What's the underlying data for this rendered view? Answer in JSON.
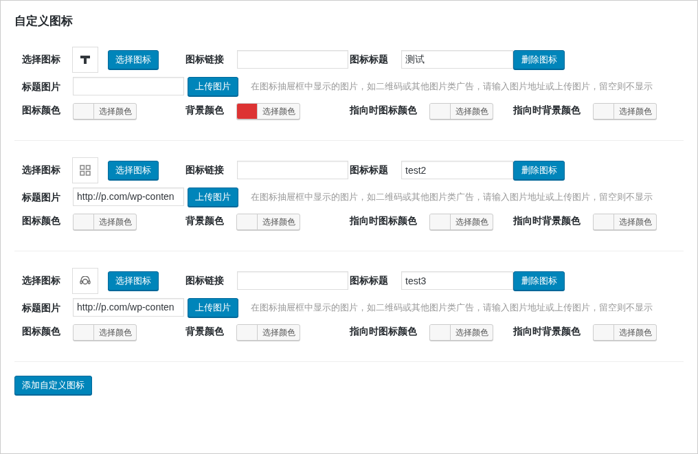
{
  "title": "自定义图标",
  "groups": [
    {
      "icon_label": "选择图标",
      "icon_preview": {
        "kind": "tee"
      },
      "choose_button": "选择图标",
      "link_label": "图标链接",
      "title_label": "图标标题",
      "title_value": "测试",
      "delete_button": "删除图标",
      "image_label": "标题图片",
      "upload_button": "上传图片",
      "hint": "在图标抽屉框中显示的图片，如二维码或其他图片类广告，请输入图片地址或上传图片，留空则不显示",
      "colors": [
        {
          "label": "图标颜色",
          "button": "选择颜色"
        },
        {
          "label": "背景颜色",
          "button": "选择颜色",
          "color": "#dd3333"
        },
        {
          "label": "指向时图标颜色",
          "button": "选择颜色"
        },
        {
          "label": "指向时背景颜色",
          "button": "选择颜色"
        }
      ]
    },
    {
      "icon_label": "选择图标",
      "icon_preview": {
        "kind": "grid"
      },
      "choose_button": "选择图标",
      "link_label": "图标链接",
      "title_label": "图标标题",
      "title_value": "test2",
      "delete_button": "删除图标",
      "image_label": "标题图片",
      "image_value": "http://p.com/wp-conten",
      "upload_button": "上传图片",
      "hint": "在图标抽屉框中显示的图片，如二维码或其他图片类广告，请输入图片地址或上传图片，留空则不显示",
      "colors": [
        {
          "label": "图标颜色",
          "button": "选择颜色"
        },
        {
          "label": "背景颜色",
          "button": "选择颜色"
        },
        {
          "label": "指向时图标颜色",
          "button": "选择颜色"
        },
        {
          "label": "指向时背景颜色",
          "button": "选择颜色"
        }
      ]
    },
    {
      "icon_label": "选择图标",
      "icon_preview": {
        "kind": "headset"
      },
      "choose_button": "选择图标",
      "link_label": "图标链接",
      "title_label": "图标标题",
      "title_value": "test3",
      "delete_button": "删除图标",
      "image_label": "标题图片",
      "image_value": "http://p.com/wp-conten",
      "upload_button": "上传图片",
      "hint": "在图标抽屉框中显示的图片，如二维码或其他图片类广告，请输入图片地址或上传图片，留空则不显示",
      "colors": [
        {
          "label": "图标颜色",
          "button": "选择颜色"
        },
        {
          "label": "背景颜色",
          "button": "选择颜色"
        },
        {
          "label": "指向时图标颜色",
          "button": "选择颜色"
        },
        {
          "label": "指向时背景颜色",
          "button": "选择颜色"
        }
      ]
    }
  ],
  "add_button": "添加自定义图标"
}
